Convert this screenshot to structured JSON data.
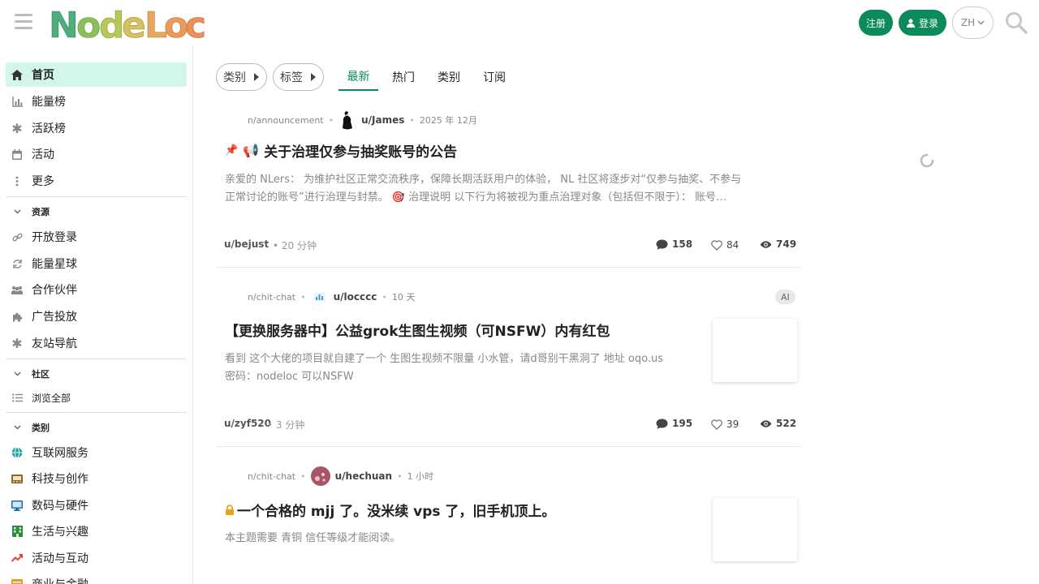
{
  "header": {
    "logo_text": "NodeLoc",
    "register_label": "注册",
    "login_label": "登录",
    "lang_label": "ZH"
  },
  "sidebar": {
    "nav": [
      {
        "label": "首页",
        "icon": "home-icon",
        "active": true
      },
      {
        "label": "能量榜",
        "icon": "chart-icon"
      },
      {
        "label": "活跃榜",
        "icon": "asterisk-icon"
      },
      {
        "label": "活动",
        "icon": "calendar-icon"
      },
      {
        "label": "更多",
        "icon": "more-vertical-icon"
      }
    ],
    "resources_title": "资源",
    "resources": [
      {
        "label": "开放登录",
        "icon": "link-icon"
      },
      {
        "label": "能量星球",
        "icon": "refresh-icon"
      },
      {
        "label": "合作伙伴",
        "icon": "users-icon"
      },
      {
        "label": "广告投放",
        "icon": "puzzle-icon"
      },
      {
        "label": "友站导航",
        "icon": "asterisk-icon"
      }
    ],
    "community_title": "社区",
    "community": [
      {
        "label": "浏览全部",
        "icon": "list-icon"
      }
    ],
    "categories_title": "类别",
    "categories": [
      {
        "label": "互联网服务",
        "icon": "globe-icon",
        "color": "#1aa3a3"
      },
      {
        "label": "科技与创作",
        "icon": "book-icon",
        "color": "#8a6a2a"
      },
      {
        "label": "数码与硬件",
        "icon": "monitor-icon",
        "color": "#1a6fb5"
      },
      {
        "label": "生活与兴趣",
        "icon": "building-icon",
        "color": "#2e8b3c"
      },
      {
        "label": "活动与互动",
        "icon": "trend-icon",
        "color": "#e0442a"
      },
      {
        "label": "商业与金融",
        "icon": "finance-icon",
        "color": "#e0a020"
      }
    ]
  },
  "filters": {
    "category_label": "类别",
    "tag_label": "标签",
    "tabs": [
      "最新",
      "热门",
      "类别",
      "订阅"
    ]
  },
  "topics": [
    {
      "category": "n/announcement",
      "author": "u/James",
      "time": "2025 年 12月",
      "title": "关于治理仅参与抽奖账号的公告",
      "excerpt_line1": "亲爱的 NLers： 为维护社区正常交流秩序，保障长期活跃用户的体验， NL 社区将逐步对“仅参与抽奖、不参与",
      "excerpt_line2": "正常讨论的账号”进行治理与封禁。 🎯 治理说明 以下行为将被视为重点治理对象（包括但不限于）： 账号…",
      "last_user": "u/bejust",
      "last_time": "20 分钟",
      "replies": "158",
      "likes": "84",
      "views": "749"
    },
    {
      "category": "n/chit-chat",
      "author": "u/locccc",
      "time": "10 天",
      "tag": "AI",
      "title": "【更换服务器中】公益grok生图生视频（可NSFW）内有红包",
      "excerpt_line1": "看到 这个大佬的项目就自建了一个 生图生视频不限量 小水管，请d哥别干黑洞了 地址 oqo.us",
      "excerpt_line2": "密码：nodeloc 可以NSFW",
      "last_user": "u/zyf520",
      "last_time": "3 分钟",
      "replies": "195",
      "likes": "39",
      "views": "522"
    },
    {
      "category": "n/chit-chat",
      "author": "u/hechuan",
      "time": "1 小时",
      "title": "一个合格的 mjj 了。没米续 vps 了，旧手机顶上。",
      "excerpt_line1": "本主题需要 青铜 信任等级才能阅读。"
    }
  ],
  "colors": {
    "accent": "#0b8a5a",
    "active_bg": "#d3f6ea"
  }
}
